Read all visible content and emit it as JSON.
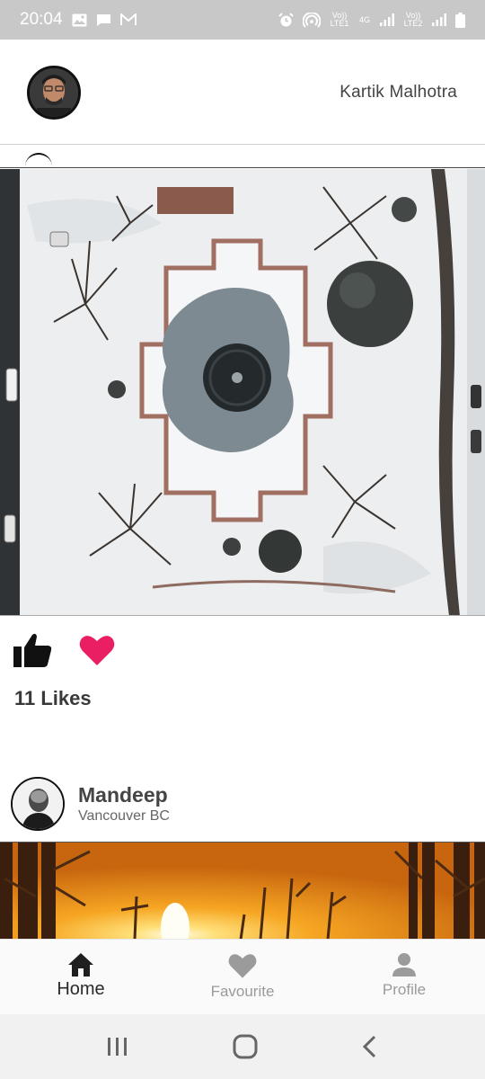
{
  "status_bar": {
    "time": "20:04",
    "left_icons": [
      "image-icon",
      "message-icon",
      "gmail-icon"
    ],
    "right_icons": [
      "alarm-icon",
      "hotspot-icon",
      "volte1-icon",
      "4g-icon",
      "signal-icon",
      "volte2-icon",
      "signal-icon",
      "battery-icon"
    ],
    "volte1": "Vo)) LTE1",
    "net": "4G",
    "volte2": "Vo)) LTE2"
  },
  "header": {
    "user_name": "Kartik Malhotra"
  },
  "post1": {
    "likes_text": "11 Likes",
    "like_icon": "thumbs-up-icon",
    "fav_icon": "heart-icon",
    "accent": "#e91e63"
  },
  "post2": {
    "author": "Mandeep",
    "location": "Vancouver BC"
  },
  "bottom_nav": {
    "items": [
      {
        "label": "Home",
        "icon": "home-icon",
        "active": true
      },
      {
        "label": "Favourite",
        "icon": "heart-icon",
        "active": false
      },
      {
        "label": "Profile",
        "icon": "person-icon",
        "active": false
      }
    ]
  },
  "system_nav": [
    "recents-icon",
    "home-circle-icon",
    "back-icon"
  ]
}
